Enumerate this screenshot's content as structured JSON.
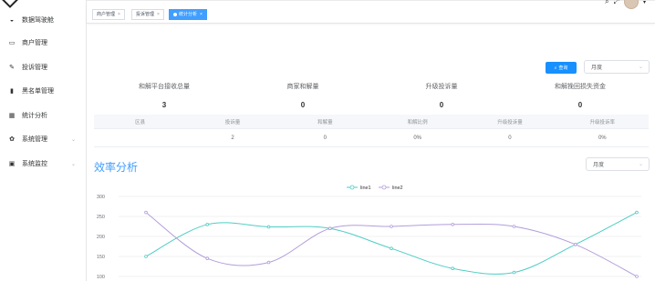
{
  "sidebar": {
    "items": [
      {
        "label": "数据驾驶舱",
        "icon": "dashboard-icon"
      },
      {
        "label": "商户管理",
        "icon": "merchant-icon"
      },
      {
        "label": "投诉管理",
        "icon": "complaint-icon"
      },
      {
        "label": "黑名单管理",
        "icon": "blacklist-icon"
      },
      {
        "label": "统计分析",
        "icon": "statistics-icon"
      },
      {
        "label": "系统管理",
        "icon": "gear-icon",
        "expandable": true
      },
      {
        "label": "系统监控",
        "icon": "monitor-icon",
        "expandable": true
      }
    ]
  },
  "tags": [
    {
      "label": "商户管理"
    },
    {
      "label": "投诉管理"
    },
    {
      "label": "统计分析",
      "active": true
    }
  ],
  "overview": {
    "search_label": "查询",
    "period_value": "月度"
  },
  "stats": [
    {
      "title": "和解平台接收总量",
      "value": "3"
    },
    {
      "title": "商家和解量",
      "value": "0"
    },
    {
      "title": "升级投诉量",
      "value": "0"
    },
    {
      "title": "和解挽回损失资金",
      "value": "0"
    }
  ],
  "table": {
    "headers": [
      "区县",
      "投诉量",
      "和解量",
      "和解比例",
      "升级投诉量",
      "升级投诉率"
    ],
    "rows": [
      [
        "",
        "2",
        "0",
        "0%",
        "0",
        "0%"
      ]
    ]
  },
  "efficiency": {
    "title": "效率分析",
    "period_value": "月度"
  },
  "colors": {
    "accent": "#409eff",
    "line1": "#4ecdc4",
    "line2": "#b39ddb"
  },
  "chart_data": {
    "type": "line",
    "legend": [
      "line1",
      "line2"
    ],
    "legend_position": "top-center",
    "ylim": [
      100,
      300
    ],
    "yticks": [
      100,
      150,
      200,
      250,
      300
    ],
    "grid": true,
    "x": [
      1,
      2,
      3,
      4,
      5,
      6,
      7,
      8,
      9
    ],
    "series": [
      {
        "name": "line1",
        "values": [
          150,
          230,
          224,
          220,
          170,
          120,
          110,
          180,
          260
        ]
      },
      {
        "name": "line2",
        "values": [
          260,
          145,
          135,
          220,
          225,
          230,
          225,
          180,
          100
        ]
      }
    ]
  }
}
